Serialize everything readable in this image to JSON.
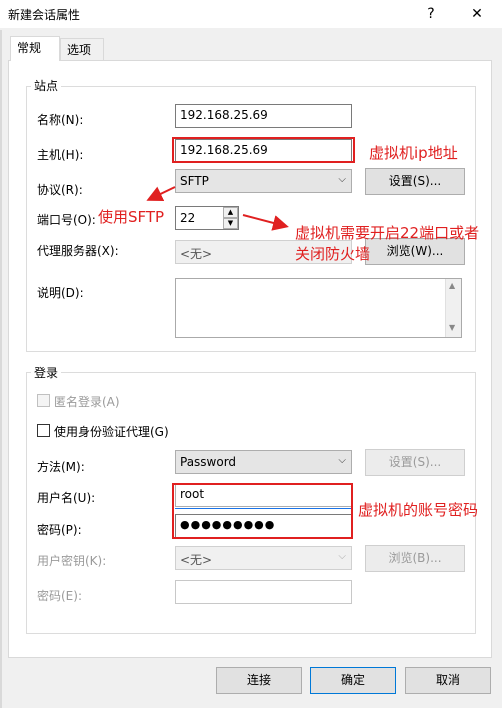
{
  "window": {
    "title": "新建会话属性",
    "help_button": "?",
    "close_button": "✕"
  },
  "tabs": [
    "常规",
    "选项"
  ],
  "site_group": {
    "title": "站点",
    "name_label": "名称(N):",
    "name_value": "192.168.25.69",
    "host_label": "主机(H):",
    "host_value": "192.168.25.69",
    "protocol_label": "协议(R):",
    "protocol_value": "SFTP",
    "settings_button": "设置(S)...",
    "port_label": "端口号(O):",
    "port_value": "22",
    "proxy_label": "代理服务器(X):",
    "proxy_value": "<无>",
    "browse_button": "浏览(W)...",
    "description_label": "说明(D):"
  },
  "login_group": {
    "title": "登录",
    "anonymous_label": "匿名登录(A)",
    "identity_agent_label": "使用身份验证代理(G)",
    "method_label": "方法(M):",
    "method_value": "Password",
    "settings_button": "设置(S)...",
    "username_label": "用户名(U):",
    "username_value": "root",
    "password_label": "密码(P):",
    "password_value": "●●●●●●●●●",
    "user_key_label": "用户密钥(K):",
    "user_key_value": "<无>",
    "browse_button": "浏览(B)...",
    "passphrase_label": "密码(E):"
  },
  "footer": {
    "connect_button": "连接",
    "ok_button": "确定",
    "cancel_button": "取消"
  },
  "annotations": {
    "host_note": "虚拟机ip地址",
    "sftp_note": "使用SFTP",
    "port_note_line1": "虚拟机需要开启22端口或者",
    "port_note_line2": "关闭防火墙",
    "account_note": "虚拟机的账号密码",
    "color": "#e02020"
  }
}
